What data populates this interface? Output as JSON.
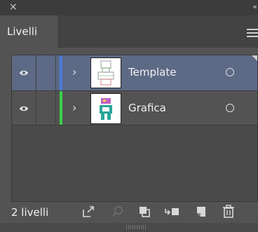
{
  "window": {
    "close_glyph": "×",
    "collapse_glyph": "‹‹"
  },
  "tabs": [
    {
      "label": "Livelli"
    }
  ],
  "layers": [
    {
      "name": "Template",
      "color": "#4a7bd8",
      "selected": true
    },
    {
      "name": "Grafica",
      "color": "#3ad14a",
      "selected": false
    }
  ],
  "footer": {
    "count_label": "2 livelli"
  },
  "colors": {
    "selected_row": "#5c6a85",
    "panel_bg": "#535353"
  },
  "icons": {
    "export": "export-icon",
    "search": "search-icon",
    "clip": "clipping-mask-icon",
    "move": "move-to-layer-icon",
    "new": "new-layer-icon",
    "trash": "trash-icon"
  }
}
